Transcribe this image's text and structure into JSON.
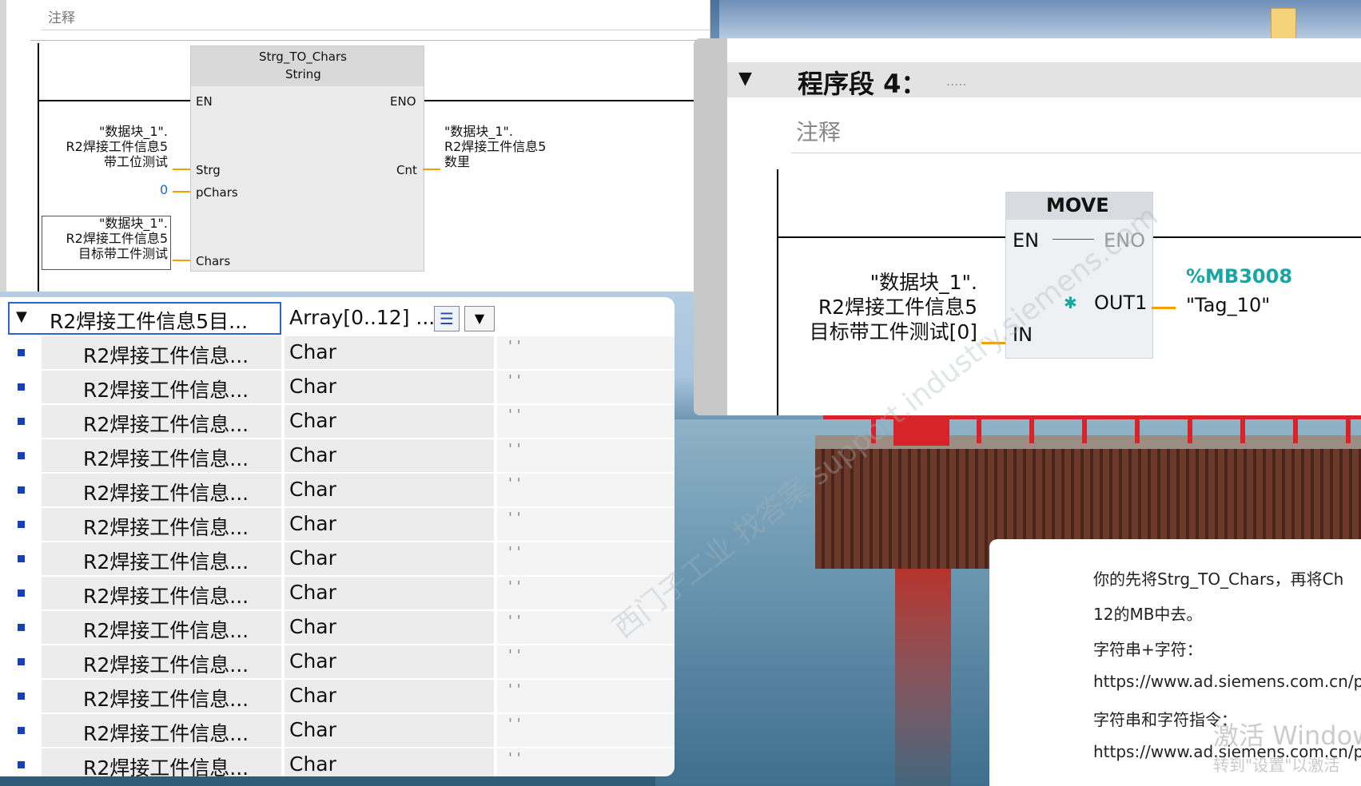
{
  "panel1": {
    "comment": "注释",
    "block_name": "Strg_TO_Chars",
    "block_type": "String",
    "en": "EN",
    "eno": "ENO",
    "pin_strg": "Strg",
    "pin_pchars": "pChars",
    "pin_chars": "Chars",
    "pin_cnt": "Cnt",
    "strg_tag": [
      "\"数据块_1\".",
      "R2焊接工件信息5",
      "带工位测试"
    ],
    "pchars_value": "0",
    "chars_tag": [
      "\"数据块_1\".",
      "R2焊接工件信息5",
      "目标带工件测试"
    ],
    "cnt_tag": [
      "\"数据块_1\".",
      "R2焊接工件信息5",
      "数里"
    ]
  },
  "panel2": {
    "segment_title": "程序段 4：",
    "segment_dots": ".....",
    "comment": "注释",
    "block_name": "MOVE",
    "en": "EN",
    "eno": "ENO",
    "pin_in": "IN",
    "pin_out1": "OUT1",
    "in_tag": [
      "\"数据块_1\".",
      "R2焊接工件信息5",
      "目标带工件测试[0]"
    ],
    "out_address": "%MB3008",
    "out_tag": "\"Tag_10\""
  },
  "table": {
    "header": {
      "name": "R2焊接工件信息5目...",
      "type": "Array[0..12] ..."
    },
    "rows": [
      {
        "name": "R2焊接工件信息...",
        "type": "Char",
        "default": "' '"
      },
      {
        "name": "R2焊接工件信息...",
        "type": "Char",
        "default": "' '"
      },
      {
        "name": "R2焊接工件信息...",
        "type": "Char",
        "default": "' '"
      },
      {
        "name": "R2焊接工件信息...",
        "type": "Char",
        "default": "' '"
      },
      {
        "name": "R2焊接工件信息...",
        "type": "Char",
        "default": "' '"
      },
      {
        "name": "R2焊接工件信息...",
        "type": "Char",
        "default": "' '"
      },
      {
        "name": "R2焊接工件信息...",
        "type": "Char",
        "default": "' '"
      },
      {
        "name": "R2焊接工件信息...",
        "type": "Char",
        "default": "' '"
      },
      {
        "name": "R2焊接工件信息...",
        "type": "Char",
        "default": "' '"
      },
      {
        "name": "R2焊接工件信息...",
        "type": "Char",
        "default": "' '"
      },
      {
        "name": "R2焊接工件信息...",
        "type": "Char",
        "default": "' '"
      },
      {
        "name": "R2焊接工件信息...",
        "type": "Char",
        "default": "' '"
      },
      {
        "name": "R2焊接工件信息...",
        "type": "Char",
        "default": "' '"
      }
    ]
  },
  "answer": {
    "lines": [
      "你的先将Strg_TO_Chars，再将Ch",
      "12的MB中去。",
      "字符串+字符：",
      "https://www.ad.siemens.com.cn/pr",
      "字符串和字符指令：",
      "https://www.ad.siemens.com.cn/pr"
    ]
  },
  "watermarks": {
    "activate": "激活 Window",
    "activate_sub": "转到\"设置\"以激活",
    "forum": "西门子工业 找答案 support.industry.siemens.com"
  },
  "colors": {
    "accent_orange": "#f0a000",
    "address_teal": "#1aa6a0",
    "link_blue": "#1e66c8"
  }
}
